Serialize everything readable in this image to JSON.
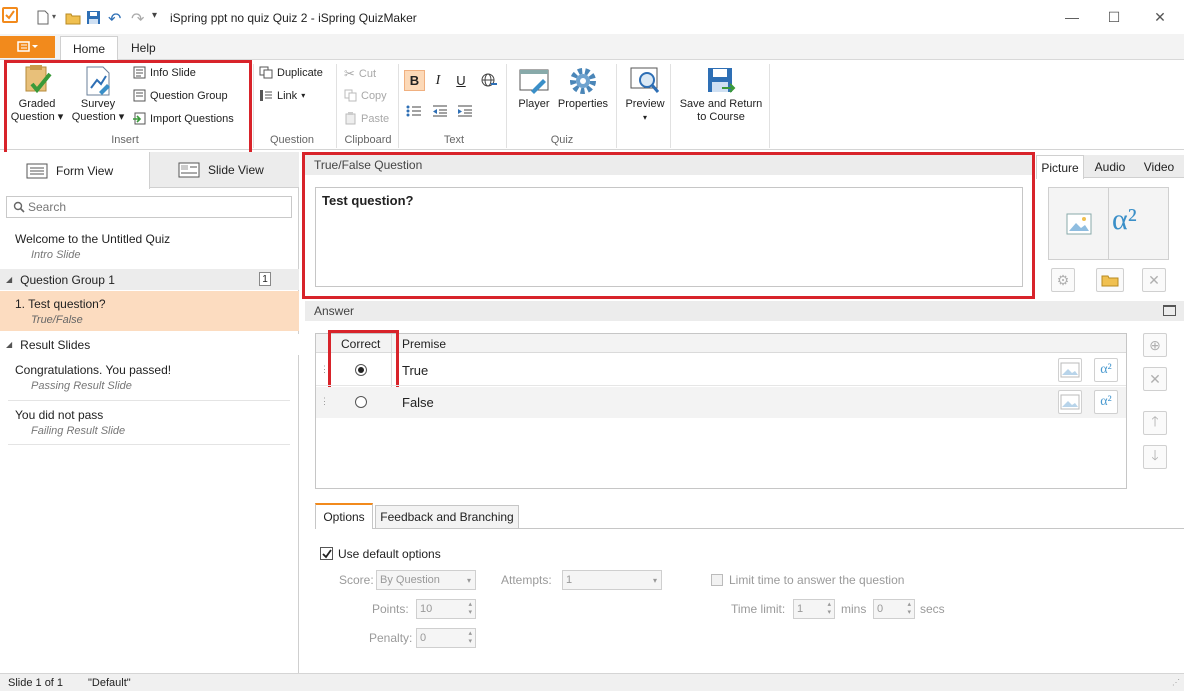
{
  "window": {
    "title": "iSpring ppt no quiz Quiz 2 - iSpring QuizMaker",
    "minimize": "—",
    "maximize": "☐",
    "close": "✕"
  },
  "ribbon_tabs": [
    "Home",
    "Help"
  ],
  "ribbon": {
    "insert": {
      "graded": "Graded",
      "graded2": "Question",
      "survey": "Survey",
      "survey2": "Question",
      "info_slide": "Info Slide",
      "question_group": "Question Group",
      "import_questions": "Import Questions",
      "label": "Insert"
    },
    "question": {
      "duplicate": "Duplicate",
      "link": "Link",
      "label": "Question"
    },
    "clipboard": {
      "cut": "Cut",
      "copy": "Copy",
      "paste": "Paste",
      "label": "Clipboard"
    },
    "text": {
      "bold": "B",
      "italic": "I",
      "underline": "U",
      "label": "Text"
    },
    "quiz": {
      "player": "Player",
      "properties": "Properties",
      "label": "Quiz"
    },
    "preview": {
      "label": "Preview"
    },
    "save": {
      "line1": "Save and Return",
      "line2": "to Course"
    }
  },
  "left_panel": {
    "tab_form": "Form View",
    "tab_slide": "Slide View",
    "search_placeholder": "Search",
    "intro": {
      "title": "Welcome to the Untitled Quiz",
      "sub": "Intro Slide"
    },
    "group1": {
      "title": "Question Group 1",
      "count": "1"
    },
    "question1": {
      "title": "1. Test question?",
      "sub": "True/False"
    },
    "result_group": "Result Slides",
    "pass": {
      "title": "Congratulations. You passed!",
      "sub": "Passing Result Slide"
    },
    "fail": {
      "title": "You did not pass",
      "sub": "Failing Result Slide"
    }
  },
  "question": {
    "header": "True/False Question",
    "text": "Test question?"
  },
  "media_tabs": [
    "Picture",
    "Audio",
    "Video"
  ],
  "media": {
    "alpha": "α²"
  },
  "answer": {
    "header": "Answer",
    "col_correct": "Correct",
    "col_premise": "Premise",
    "rows": [
      {
        "label": "True",
        "selected": true
      },
      {
        "label": "False",
        "selected": false
      }
    ]
  },
  "options_tabs": [
    "Options",
    "Feedback and Branching"
  ],
  "options": {
    "use_default": "Use default options",
    "score_label": "Score:",
    "score_value": "By Question",
    "attempts_label": "Attempts:",
    "attempts_value": "1",
    "points_label": "Points:",
    "points_value": "10",
    "penalty_label": "Penalty:",
    "penalty_value": "0",
    "limit_time": "Limit time to answer the question",
    "time_limit_label": "Time limit:",
    "mins_value": "1",
    "mins_label": "mins",
    "secs_value": "0",
    "secs_label": "secs"
  },
  "status": {
    "slide": "Slide 1 of 1",
    "theme": "\"Default\""
  },
  "colors": {
    "accent": "#f28a1c",
    "highlight": "#d8232a",
    "selected_row": "#fcdcc0",
    "icon_blue": "#3a8fc8"
  }
}
